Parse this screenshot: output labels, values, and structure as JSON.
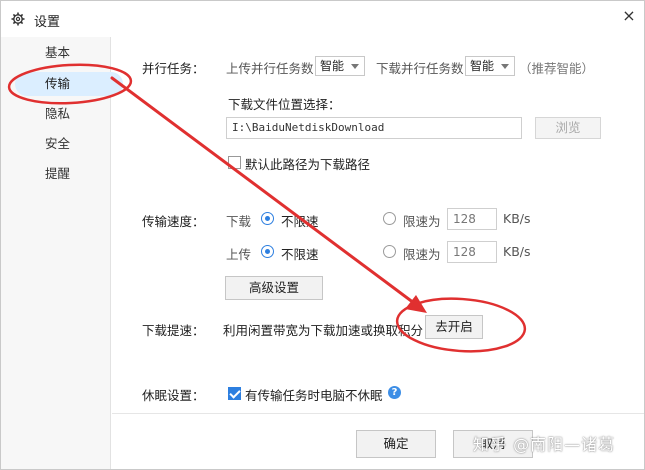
{
  "window": {
    "title": "设置",
    "close_glyph": "×"
  },
  "sidebar": {
    "items": [
      {
        "label": "基本"
      },
      {
        "label": "传输"
      },
      {
        "label": "隐私"
      },
      {
        "label": "安全"
      },
      {
        "label": "提醒"
      }
    ],
    "active_index": 1
  },
  "parallel": {
    "label": "并行任务：",
    "upload_label": "上传并行任务数",
    "upload_value": "智能",
    "download_label": "下载并行任务数",
    "download_value": "智能",
    "hint": "（推荐智能）"
  },
  "location": {
    "label": "下载文件位置选择：",
    "path": "I:\\BaiduNetdiskDownload",
    "browse_label": "浏览",
    "default_checkbox_label": "默认此路径为下载路径",
    "default_checked": false
  },
  "speed": {
    "label": "传输速度：",
    "download": {
      "label": "下载",
      "unlimited_label": "不限速",
      "limit_label": "限速为",
      "limit_value": "128",
      "unit": "KB/s",
      "unlimited_selected": true
    },
    "upload": {
      "label": "上传",
      "unlimited_label": "不限速",
      "limit_label": "限速为",
      "limit_value": "128",
      "unit": "KB/s",
      "unlimited_selected": true
    },
    "advanced_label": "高级设置"
  },
  "boost": {
    "label": "下载提速：",
    "description": "利用闲置带宽为下载加速或换取积分",
    "button_label": "去开启"
  },
  "sleep": {
    "label": "休眠设置：",
    "checkbox_label": "有传输任务时电脑不休眠",
    "checked": true,
    "help_glyph": "?"
  },
  "footer": {
    "ok_label": "确定",
    "cancel_label": "取消"
  },
  "watermark": "知乎 @南阳—诸葛",
  "colors": {
    "annotation_red": "#e03030",
    "accent_blue": "#2d7fe0",
    "active_tab_bg": "#dbeeff"
  }
}
